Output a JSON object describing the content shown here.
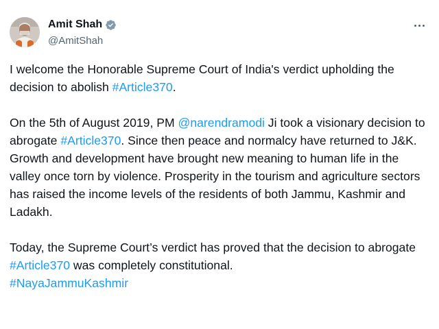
{
  "author": {
    "name": "Amit Shah",
    "handle": "@AmitShah",
    "verified_color": "#829aab",
    "icons": [
      "verified-badge-icon",
      "more-options-icon"
    ]
  },
  "tweet": {
    "p1": {
      "t1": "I welcome the Honorable Supreme Court of India's verdict upholding the decision to abolish ",
      "tag1": "#Article370",
      "t2": "."
    },
    "p2": {
      "t1": "On the 5th of August 2019, PM ",
      "mention": "@narendramodi",
      "t2": " Ji took a visionary decision to abrogate ",
      "tag1": "#Article370",
      "t3": ". Since then peace and normalcy have returned to J&K. Growth and development have brought new meaning to human life in the valley once torn by violence. Prosperity in the tourism and agriculture sectors has raised the income levels of the residents of both Jammu, Kashmir and Ladakh."
    },
    "p3": {
      "t1": "Today, the Supreme Court’s verdict has proved that the decision to abrogate ",
      "tag1": "#Article370",
      "t2": " was completely constitutional.",
      "tag2": "#NayaJammuKashmir"
    }
  },
  "colors": {
    "text": "#0f1419",
    "secondary": "#536471",
    "link": "#1d9bf0"
  }
}
